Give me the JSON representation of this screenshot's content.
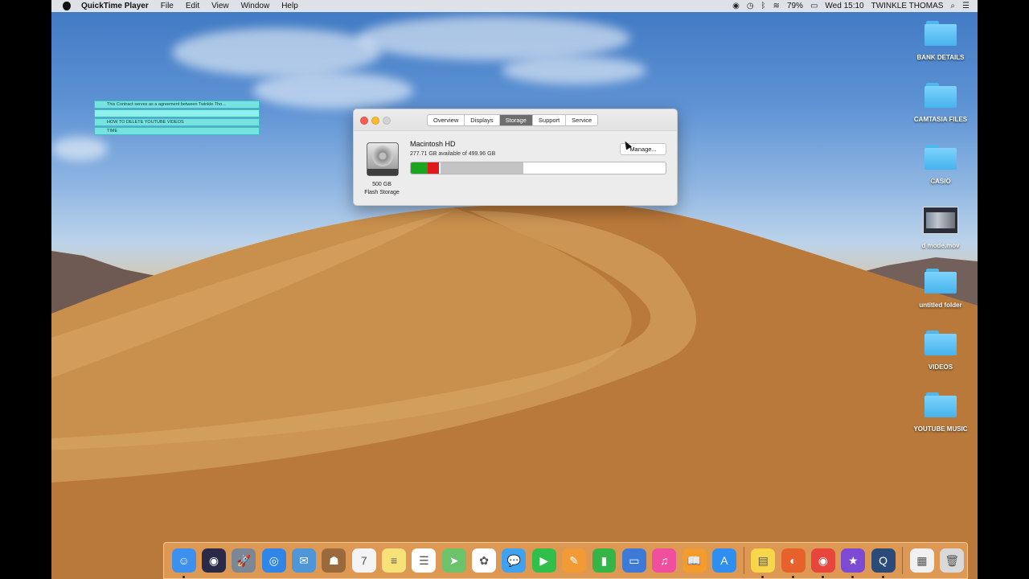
{
  "menubar": {
    "app_name": "QuickTime Player",
    "menus": [
      "File",
      "Edit",
      "View",
      "Window",
      "Help"
    ],
    "battery": "79%",
    "clock": "Wed 15:10",
    "user": "TWINKLE THOMAS"
  },
  "sticky_list": {
    "items": [
      "This Contract serves as a agreement between Twinkle Tho...",
      "",
      "HOW TO DELETE YOUTUBE VIDEOS",
      "TIME"
    ]
  },
  "about_window": {
    "tabs": [
      "Overview",
      "Displays",
      "Storage",
      "Support",
      "Service"
    ],
    "active_tab": "Storage",
    "disk_name": "Macintosh HD",
    "disk_available": "277.71 GB available of 499.96 GB",
    "manage_label": "Manage...",
    "capacity_line1": "500 GB",
    "capacity_line2": "Flash Storage",
    "storage_bar": {
      "segments": [
        {
          "category": "green",
          "fraction": 0.065,
          "color": "#1aa41f"
        },
        {
          "category": "red",
          "fraction": 0.045,
          "color": "#e2191b"
        },
        {
          "category": "gap",
          "fraction": 0.006,
          "color": "#ffffff"
        },
        {
          "category": "grey",
          "fraction": 0.325,
          "color": "#c3c3c3"
        }
      ],
      "free_color": "#ffffff"
    }
  },
  "desktop_icons": [
    {
      "label": "BANK DETAILS",
      "type": "folder"
    },
    {
      "label": "CAMTASIA FILES",
      "type": "folder"
    },
    {
      "label": "CASIO",
      "type": "folder"
    },
    {
      "label": "d mode.mov",
      "type": "movie"
    },
    {
      "label": "untitled folder",
      "type": "folder"
    },
    {
      "label": "VIDEOS",
      "type": "folder"
    },
    {
      "label": "YOUTUBE MUSIC",
      "type": "folder"
    }
  ],
  "dock": {
    "apps": [
      {
        "name": "finder-icon",
        "color": "#3d8ff0",
        "glyph": "☺",
        "running": true
      },
      {
        "name": "siri-icon",
        "color": "#2a2a48",
        "glyph": "◉",
        "running": false
      },
      {
        "name": "launchpad-icon",
        "color": "#7c8796",
        "glyph": "🚀",
        "running": false
      },
      {
        "name": "safari-icon",
        "color": "#2f86e8",
        "glyph": "◎",
        "running": false
      },
      {
        "name": "mail-icon",
        "color": "#4f96d8",
        "glyph": "✉",
        "running": false
      },
      {
        "name": "contacts-icon",
        "color": "#9a6a3c",
        "glyph": "☗",
        "running": false
      },
      {
        "name": "calendar-icon",
        "color": "#f4f4f4",
        "glyph": "7",
        "running": false
      },
      {
        "name": "notes-icon",
        "color": "#f7e27a",
        "glyph": "≡",
        "running": false
      },
      {
        "name": "reminders-icon",
        "color": "#ffffff",
        "glyph": "☰",
        "running": false
      },
      {
        "name": "maps-icon",
        "color": "#6cc36b",
        "glyph": "➤",
        "running": false
      },
      {
        "name": "photos-icon",
        "color": "#ffffff",
        "glyph": "✿",
        "running": false
      },
      {
        "name": "messages-icon",
        "color": "#3ea2f0",
        "glyph": "💬",
        "running": false
      },
      {
        "name": "facetime-icon",
        "color": "#2fbf4a",
        "glyph": "▶",
        "running": false
      },
      {
        "name": "pages-icon",
        "color": "#f29a36",
        "glyph": "✎",
        "running": false
      },
      {
        "name": "numbers-icon",
        "color": "#35b548",
        "glyph": "▮",
        "running": false
      },
      {
        "name": "keynote-icon",
        "color": "#3d7ad8",
        "glyph": "▭",
        "running": false
      },
      {
        "name": "itunes-icon",
        "color": "#f04fa0",
        "glyph": "♫",
        "running": false
      },
      {
        "name": "books-icon",
        "color": "#f39c2c",
        "glyph": "📖",
        "running": false
      },
      {
        "name": "app-store-icon",
        "color": "#2f8ff0",
        "glyph": "A",
        "running": false
      },
      {
        "name": "stickies-icon",
        "color": "#f7d64a",
        "glyph": "▤",
        "running": true
      },
      {
        "name": "firefox-icon",
        "color": "#e6612b",
        "glyph": "◐",
        "running": true
      },
      {
        "name": "chrome-icon",
        "color": "#e8453c",
        "glyph": "◉",
        "running": true
      },
      {
        "name": "imovie-icon",
        "color": "#7d4bd3",
        "glyph": "★",
        "running": true
      },
      {
        "name": "quicktime-icon",
        "color": "#2a4a7a",
        "glyph": "Q",
        "running": true
      }
    ],
    "trailing": [
      {
        "name": "downloads-stack-icon",
        "color": "#f0f0f0",
        "glyph": "▦",
        "running": false
      },
      {
        "name": "trash-icon",
        "color": "#d9d9d9",
        "glyph": "🗑",
        "running": false
      }
    ]
  }
}
